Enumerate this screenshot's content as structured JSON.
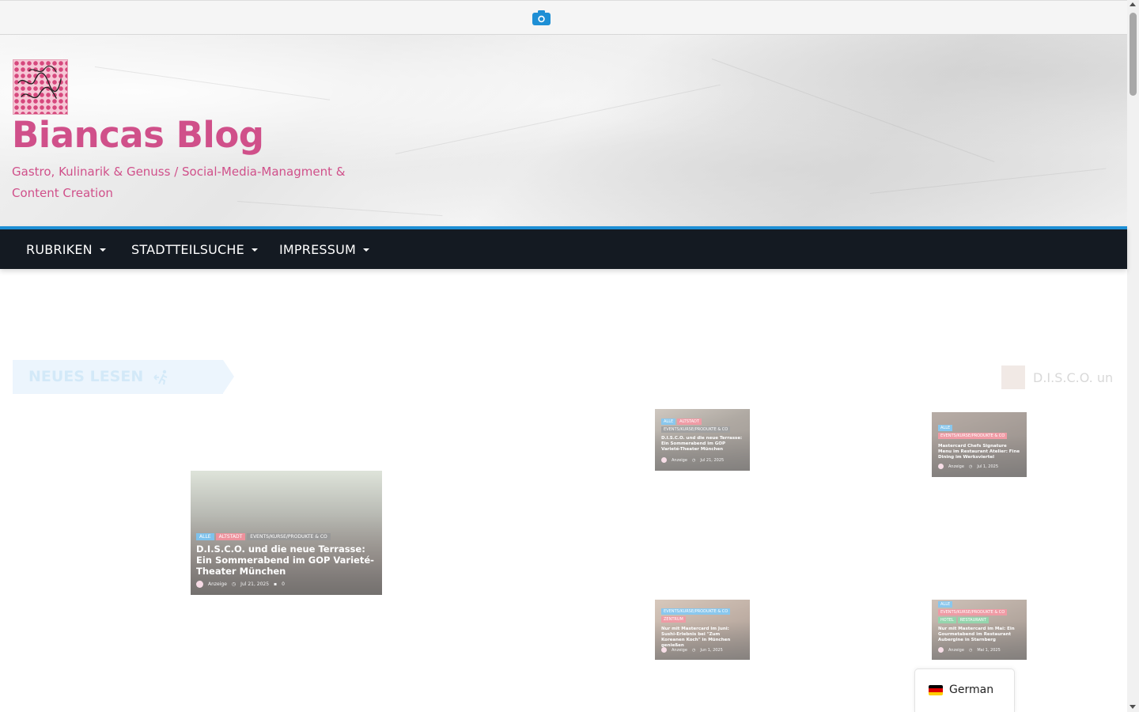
{
  "toolbar": {
    "camera_icon": "camera-icon"
  },
  "site": {
    "title": "Biancas Blog",
    "tagline": "Gastro, Kulinarik & Genuss / Social-Media-Managment & Content Creation"
  },
  "nav": {
    "items": [
      {
        "label": "RUBRIKEN"
      },
      {
        "label": "STADTTEILSUCHE"
      },
      {
        "label": "IMPRESSUM"
      }
    ]
  },
  "ticker": {
    "label": "NEUES LESEN",
    "text": "D.I.S.C.O. un"
  },
  "featured": {
    "tags": [
      "ALLE",
      "ALTSTADT",
      "EVENTS/KURSE/PRODUKTE & CO"
    ],
    "title": "D.I.S.C.O. und die neue Terrasse: Ein Sommerabend im GOP Varieté-Theater München",
    "author": "Anzeige",
    "date": "Jul 21, 2025",
    "comments": "0"
  },
  "cards": [
    {
      "tags": [
        "ALLE",
        "ALTSTADT",
        "EVENTS/KURSE/PRODUKTE & CO"
      ],
      "title": "D.I.S.C.O. und die neue Terrasse: Ein Sommerabend im GOP Varieté-Theater München",
      "author": "Anzeige",
      "date": "Jul 21, 2025"
    },
    {
      "tags": [
        "ALLE",
        "EVENTS/KURSE/PRODUKTE & CO"
      ],
      "title": "Mastercard Chefs Signature Menu im Restaurant Atelier: Fine Dining im Werksviertel",
      "author": "Anzeige",
      "date": "Jul 1, 2025"
    },
    {
      "tags": [
        "EVENTS/KURSE/PRODUKTE & CO",
        "ZENTRUM"
      ],
      "title": "Nur mit Mastercard im Juni: Sushi-Erlebnis bei \"Zum Koreanen Koch\" in München genießen",
      "author": "Anzeige",
      "date": "Jun 1, 2025"
    },
    {
      "tags": [
        "ALLE",
        "EVENTS/KURSE/PRODUKTE & CO",
        "HOTEL",
        "RESTAURANT"
      ],
      "title": "Nur mit Mastercard im Mai: Ein Gourmetabend im Restaurant Aubergine in Starnberg",
      "author": "Anzeige",
      "date": "Mai 1, 2025"
    }
  ],
  "language": {
    "label": "German",
    "flag_icon": "germany-flag-icon"
  },
  "colors": {
    "brand": "#d0508a",
    "nav_bg": "#141a22",
    "nav_accent": "#1e8fd5"
  }
}
